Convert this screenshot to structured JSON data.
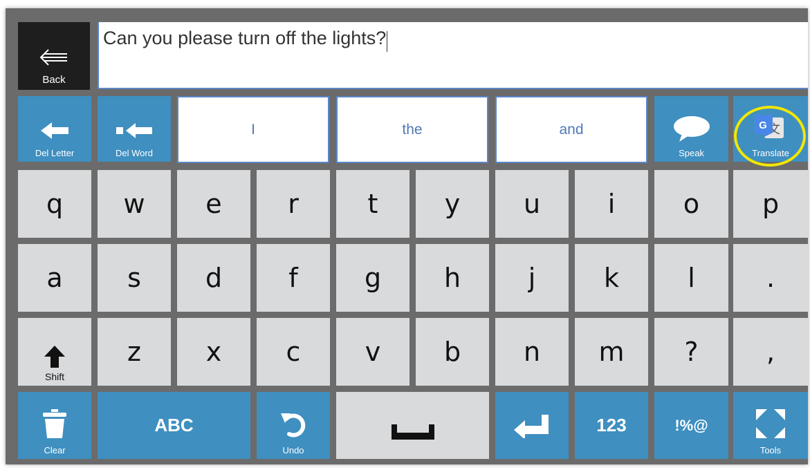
{
  "text_area": {
    "value": "Can you please turn off the lights?"
  },
  "back": {
    "label": "Back",
    "icon": "back-arrow-icon"
  },
  "toolbar": {
    "del_letter": "Del Letter",
    "del_word": "Del Word",
    "suggestions": [
      "I",
      "the",
      "and"
    ],
    "speak": "Speak",
    "translate": "Translate"
  },
  "keys": {
    "row1": [
      "q",
      "w",
      "e",
      "r",
      "t",
      "y",
      "u",
      "i",
      "o",
      "p"
    ],
    "row2": [
      "a",
      "s",
      "d",
      "f",
      "g",
      "h",
      "j",
      "k",
      "l",
      "."
    ],
    "row3": [
      "z",
      "x",
      "c",
      "v",
      "b",
      "n",
      "m",
      "?",
      ","
    ]
  },
  "shift": {
    "label": "Shift"
  },
  "bottom": {
    "clear": "Clear",
    "abc": "ABC",
    "undo": "Undo",
    "num": "123",
    "sym": "!%@",
    "tools": "Tools"
  },
  "colors": {
    "tool_blue": "#3f8fc0",
    "key_gray": "#d9dadc",
    "divider": "#6b6b6b",
    "highlight": "#f2e600",
    "text_blue": "#4f79b5"
  }
}
